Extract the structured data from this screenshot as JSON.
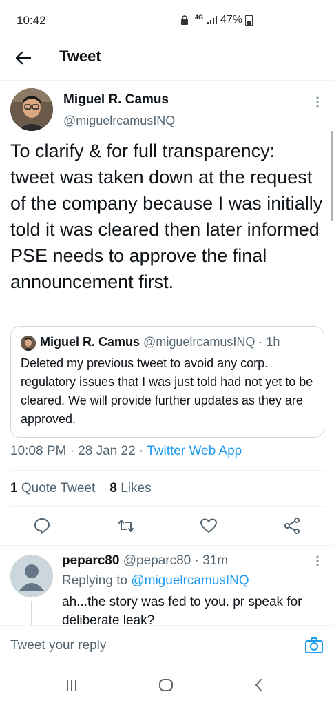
{
  "status_bar": {
    "time": "10:42",
    "network": "4G",
    "battery": "47%"
  },
  "header": {
    "title": "Tweet"
  },
  "tweet": {
    "author_name": "Miguel R. Camus",
    "author_handle": "@miguelrcamusINQ",
    "text": "To clarify & for full transparency: tweet was taken down at the request of the company because I was initially told it was cleared then later informed PSE needs to approve the final announcement first.",
    "time": "10:08 PM",
    "date": "28 Jan 22",
    "source": "Twitter Web App",
    "quote_tweets_count": "1",
    "quote_tweets_label": "Quote Tweet",
    "likes_count": "8",
    "likes_label": "Likes"
  },
  "quoted": {
    "author_name": "Miguel R. Camus",
    "author_handle": "@miguelrcamusINQ",
    "age": "1h",
    "text": "Deleted my previous tweet to avoid any corp. regulatory issues that I was just told had not yet to be cleared. We will provide further updates as they are approved."
  },
  "reply": {
    "author_name": "peparc80",
    "author_handle": "@peparc80",
    "age": "31m",
    "replying_prefix": "Replying to",
    "replying_to": "@miguelrcamusINQ",
    "text": "ah...the story was fed to you. pr speak for deliberate leak?"
  },
  "compose": {
    "placeholder": "Tweet your reply"
  },
  "colors": {
    "accent": "#1d9bf0",
    "text": "#0f1419",
    "secondary": "#536471"
  },
  "icons": [
    "back-arrow-icon",
    "more-icon",
    "reply-icon",
    "retweet-icon",
    "like-icon",
    "share-icon",
    "camera-icon",
    "recent-apps-icon",
    "home-icon",
    "back-icon"
  ]
}
